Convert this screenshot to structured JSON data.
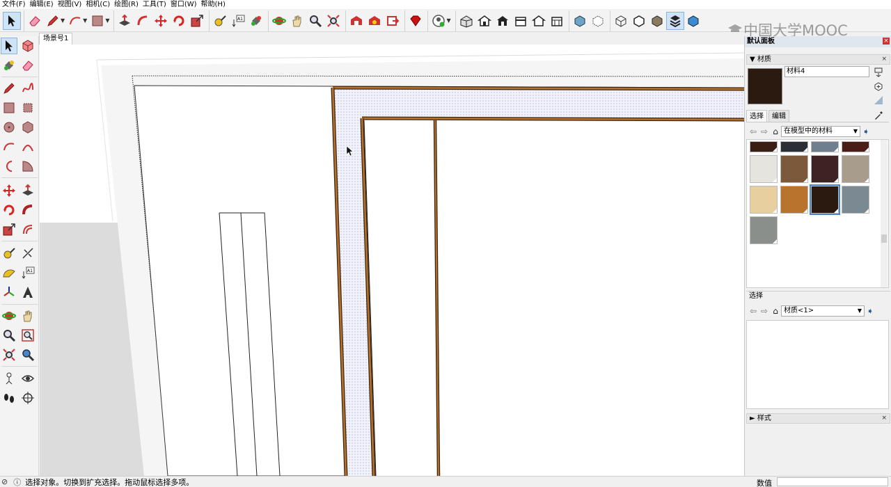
{
  "menu": [
    "文件(F)",
    "编辑(E)",
    "视图(V)",
    "相机(C)",
    "绘图(R)",
    "工具(T)",
    "窗口(W)",
    "帮助(H)"
  ],
  "toolbar_icons": [
    "select-icon",
    "eraser-icon",
    "pencil-icon",
    "arc-icon",
    "rectangle-icon",
    "pushpull-icon",
    "followme-icon",
    "move-icon",
    "rotate-icon",
    "scale-icon",
    "tape-icon",
    "text-icon",
    "paint-icon",
    "orbit-icon",
    "pan-icon",
    "zoom-icon",
    "zoom-extents-icon",
    "warehouse-icon",
    "extension-warehouse-icon",
    "send-icon",
    "ruby-icon",
    "account-icon",
    "iso-view-icon",
    "top-view-icon",
    "front-view-icon",
    "right-view-icon",
    "back-view-icon",
    "left-view-icon",
    "xray-icon",
    "wireframe-icon",
    "hidden-line-icon",
    "shaded-icon",
    "textured-icon",
    "monochrome-icon"
  ],
  "scene_tab": "场景号1",
  "watermark": "中国大学MOOC",
  "tray": {
    "title": "默认面板",
    "materials_header": "材质",
    "material_name": "材料4",
    "tab_select": "选择",
    "tab_edit": "编辑",
    "collection_select": "在模型中的材料",
    "secondary_label": "选择",
    "secondary_select": "材质<1>",
    "styles_header": "样式"
  },
  "swatches": [
    {
      "color": "#3a1f14"
    },
    {
      "color": "#2a2e35"
    },
    {
      "color": "#6f7f8d"
    },
    {
      "color": "#4a1e16"
    },
    {
      "color": "#e6e4df"
    },
    {
      "color": "#7b5a3c"
    },
    {
      "color": "#3e2325"
    },
    {
      "color": "#a89c8c"
    },
    {
      "color": "#e8cf9f"
    },
    {
      "color": "#b8742c"
    },
    {
      "color": "#2a1a0f"
    },
    {
      "color": "#7b8a92"
    },
    {
      "color": "#8a8f8c"
    }
  ],
  "status": {
    "hint": "选择对象。切换到扩充选择。拖动鼠标选择多项。",
    "measure_label": "数值",
    "measure_value": ""
  },
  "colors": {
    "frame_wood": "#b8742c",
    "frame_dark": "#3a2412",
    "accent": "#4a86c8"
  }
}
